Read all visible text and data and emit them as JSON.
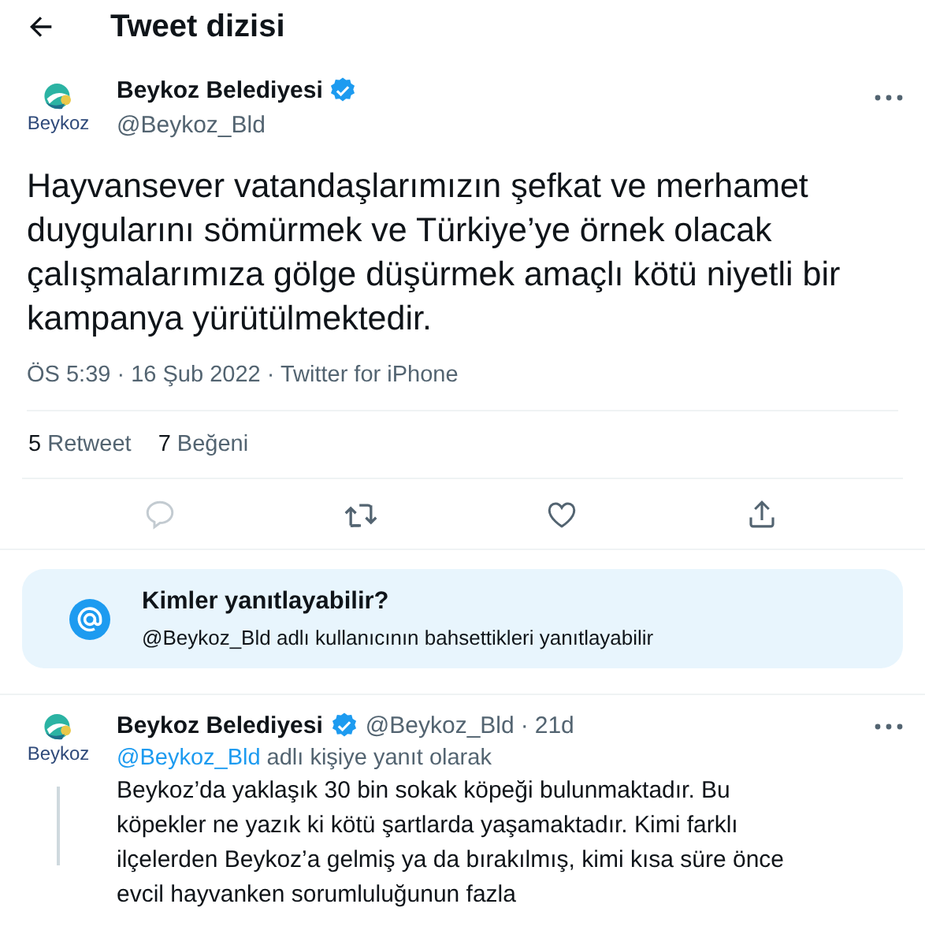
{
  "header": {
    "title": "Tweet dizisi"
  },
  "tweet": {
    "logo_text": "Beykoz",
    "name": "Beykoz Belediyesi",
    "verified": true,
    "handle": "@Beykoz_Bld",
    "text": "Hayvansever vatandaşlarımızın şefkat ve merhamet duygularını sömürmek ve Türkiye’ye örnek olacak çalışmalarımıza gölge düşürmek amaçlı kötü niyetli bir kampanya yürütülmektedir.",
    "meta": "ÖS 5:39 · 16 Şub 2022 · Twitter for iPhone",
    "stats": [
      {
        "count": "5",
        "label": "Retweet"
      },
      {
        "count": "7",
        "label": "Beğeni"
      }
    ],
    "actions": [
      {
        "kind": "reply",
        "disabled": true
      },
      {
        "kind": "retweet",
        "disabled": false
      },
      {
        "kind": "like",
        "disabled": false
      },
      {
        "kind": "share",
        "disabled": false
      }
    ]
  },
  "reply_notice": {
    "title": "Kimler yanıtlayabilir?",
    "text": "@Beykoz_Bld adlı kullanıcının bahsettikleri yanıtlayabilir"
  },
  "reply": {
    "logo_text": "Beykoz",
    "name": "Beykoz Belediyesi",
    "verified": true,
    "handle": "@Beykoz_Bld",
    "separator": "·",
    "time": "21d",
    "replying_to": "@Beykoz_Bld",
    "replying_suffix": "adlı kişiye yanıt olarak",
    "text": "Beykoz’da yaklaşık 30 bin sokak köpeği bulunmaktadır. Bu köpekler ne yazık ki kötü şartlarda yaşamaktadır. Kimi farklı ilçelerden Beykoz’a gelmiş ya da bırakılmış, kimi kısa süre önce evcil hayvanken sorumluluğunun fazla"
  }
}
